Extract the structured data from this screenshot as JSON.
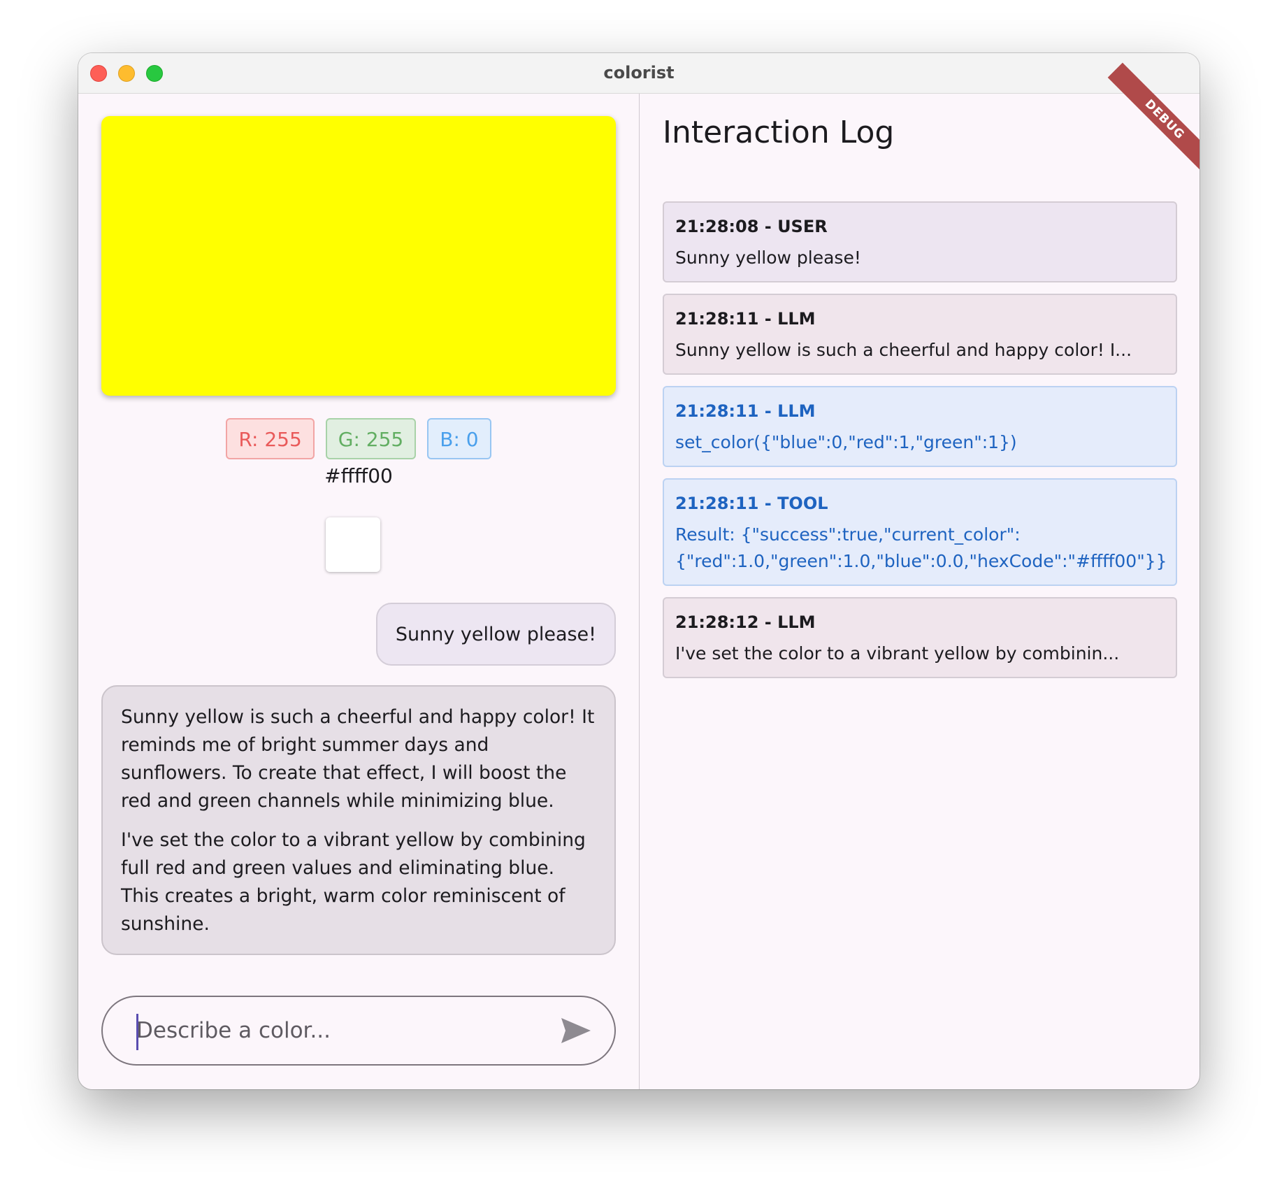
{
  "window": {
    "title": "colorist"
  },
  "swatch": {
    "color": "#ffff00"
  },
  "rgb": {
    "r_label": "R: 255",
    "g_label": "G: 255",
    "b_label": "B: 0",
    "hex": "#ffff00"
  },
  "chat": {
    "user_message": "Sunny yellow please!",
    "llm_paragraphs": [
      "Sunny yellow is such a cheerful and happy color! It reminds me of bright summer days and sunflowers. To create that effect, I will boost the red and green channels while minimizing blue.",
      "I've set the color to a vibrant yellow by combining full red and green values and eliminating blue. This creates a bright, warm color reminiscent of sunshine."
    ],
    "input_placeholder": "Describe a color...",
    "input_value": ""
  },
  "log": {
    "title": "Interaction Log",
    "entries": [
      {
        "header": "21:28:08 - USER",
        "body": "Sunny yellow please!"
      },
      {
        "header": "21:28:11 - LLM",
        "body": "Sunny yellow is such a cheerful and happy color! I..."
      },
      {
        "header": "21:28:11 - LLM",
        "body": "set_color({\"blue\":0,\"red\":1,\"green\":1})"
      },
      {
        "header": "21:28:11 - TOOL",
        "body_line1": "Result: {\"success\":true,\"current_color\":",
        "body_line2": "{\"red\":1.0,\"green\":1.0,\"blue\":0.0,\"hexCode\":\"#ffff00\"}}"
      },
      {
        "header": "21:28:12 - LLM",
        "body": "I've set the color to a vibrant yellow by combinin..."
      }
    ]
  },
  "debug_banner": "DEBUG",
  "icons": {
    "send": "send-icon"
  }
}
